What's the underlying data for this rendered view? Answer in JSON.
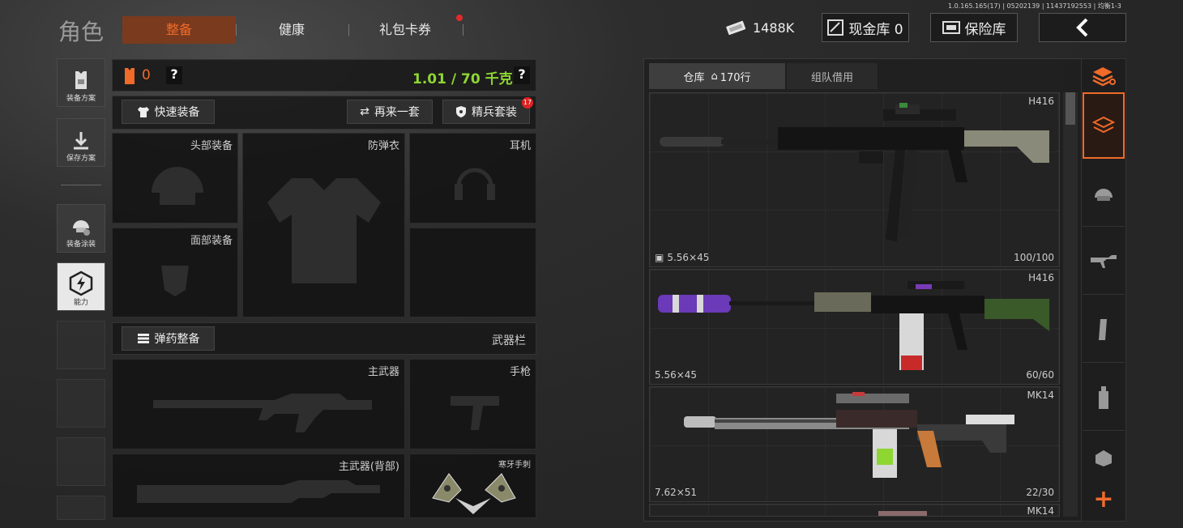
{
  "version": "1.0.165.165(17) | 05202139 | 11437192553 | 均衡1-3",
  "header": {
    "title": "角色",
    "tabs": [
      {
        "label": "整备",
        "active": true
      },
      {
        "label": "健康",
        "active": false
      },
      {
        "label": "礼包卡券",
        "active": false,
        "has_notification": true
      }
    ],
    "currency": "1488K",
    "cash_vault": "现金库 0",
    "safe_box": "保险库",
    "back": "back-arrow-icon"
  },
  "left_nav": [
    {
      "label": "装备方案",
      "icon": "armor-vest-icon"
    },
    {
      "label": "保存方案",
      "icon": "download-icon"
    },
    {
      "label": "装备涂装",
      "icon": "helmet-paint-icon"
    },
    {
      "label": "能力",
      "icon": "lightning-hexagon-icon",
      "active": true
    }
  ],
  "loadout": {
    "armor_count": "0",
    "weight": "1.01 / 70 千克",
    "help": "?",
    "quick_equip": "快速装备",
    "reroll": "再来一套",
    "elite_set": "精兵套装",
    "elite_badge": "17",
    "slots": {
      "head": "头部装备",
      "armor": "防弹衣",
      "headset": "耳机",
      "face": "面部装备"
    },
    "ammo_manage": "弹药整备",
    "weapon_bar": "武器栏",
    "weapon_slots": {
      "primary": "主武器",
      "pistol": "手枪",
      "primary_back": "主武器(背部)",
      "melee": "寒牙手刺"
    }
  },
  "warehouse": {
    "tabs": [
      {
        "label": "仓库",
        "sub": "170行",
        "active": true
      },
      {
        "label": "组队借用",
        "active": false
      }
    ],
    "items": [
      {
        "name": "H416",
        "ammo": "5.56×45",
        "durability": "100/100",
        "color": "#1a1a1a",
        "accent": "#6a6a5a",
        "has_ammo_icon": true
      },
      {
        "name": "H416",
        "ammo": "5.56×45",
        "durability": "60/60",
        "color": "#1a1a1a",
        "accent": "#7a3ab8"
      },
      {
        "name": "MK14",
        "ammo": "7.62×51",
        "durability": "22/30",
        "color": "#5a5a5a",
        "accent": "#c83a3a"
      },
      {
        "name": "MK14"
      }
    ],
    "categories": [
      "layers-refresh-icon",
      "layers-icon",
      "helmet-icon",
      "rifle-icon",
      "magazine-icon",
      "bottle-icon",
      "armor-plate-icon"
    ],
    "add": "+"
  },
  "colors": {
    "accent": "#f06a2a",
    "weight": "#8ed632",
    "tab_active_bg": "#7a3a1e"
  }
}
